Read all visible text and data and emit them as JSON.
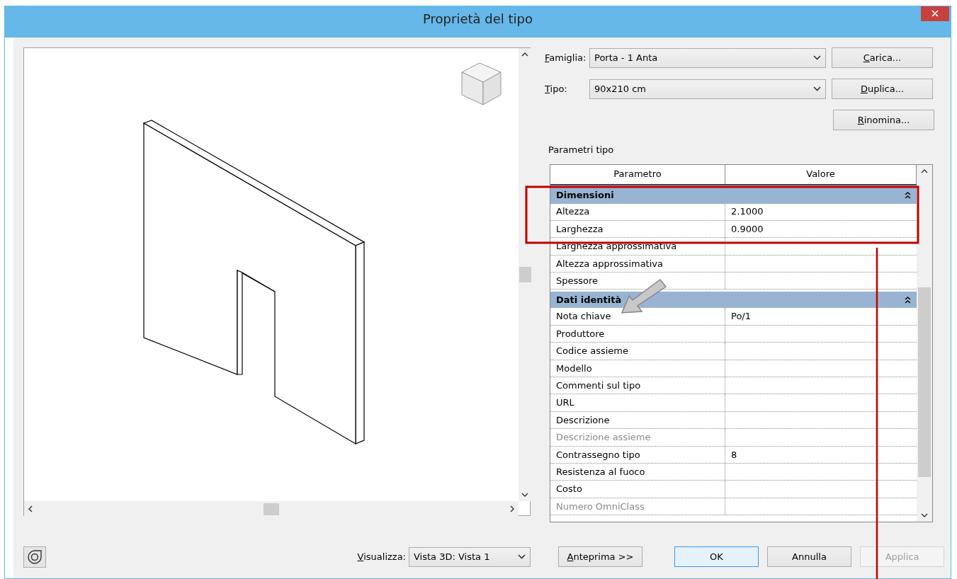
{
  "window": {
    "title": "Proprietà del tipo"
  },
  "family": {
    "label": "Famiglia:",
    "value": "Porta - 1 Anta",
    "mnemonic": true
  },
  "type": {
    "label": "Tipo:",
    "value": "90x210 cm",
    "mnemonic": true
  },
  "side_buttons": [
    {
      "label": "Carica...",
      "mnemonic": true
    },
    {
      "label": "Duplica...",
      "mnemonic": true
    },
    {
      "label": "Rinomina...",
      "mnemonic": true
    }
  ],
  "section_label": "Parametri tipo",
  "table": {
    "columns": [
      "Parametro",
      "Valore"
    ],
    "rows": [
      {
        "kind": "group",
        "label": "Dimensioni",
        "expanded": true
      },
      {
        "kind": "param",
        "name": "Altezza",
        "value": "2.1000",
        "disabled": false
      },
      {
        "kind": "param",
        "name": "Larghezza",
        "value": "0.9000",
        "disabled": false
      },
      {
        "kind": "param",
        "name": "Larghezza approssimativa",
        "disabled": false
      },
      {
        "kind": "param",
        "name": "Altezza approssimativa",
        "disabled": false
      },
      {
        "kind": "param",
        "name": "Spessore",
        "disabled": false
      },
      {
        "kind": "group",
        "label": "Dati identità",
        "expanded": true
      },
      {
        "kind": "param",
        "name": "Nota chiave",
        "value": "Po/1",
        "disabled": false
      },
      {
        "kind": "param",
        "name": "Produttore",
        "disabled": false
      },
      {
        "kind": "param",
        "name": "Codice assieme",
        "disabled": false
      },
      {
        "kind": "param",
        "name": "Modello",
        "disabled": false
      },
      {
        "kind": "param",
        "name": "Commenti sul tipo",
        "disabled": false
      },
      {
        "kind": "param",
        "name": "URL",
        "disabled": false
      },
      {
        "kind": "param",
        "name": "Descrizione",
        "disabled": false
      },
      {
        "kind": "param",
        "name": "Descrizione assieme",
        "disabled": true
      },
      {
        "kind": "param",
        "name": "Contrassegno tipo",
        "value": "8",
        "disabled": false
      },
      {
        "kind": "param",
        "name": "Resistenza al fuoco",
        "disabled": false
      },
      {
        "kind": "param",
        "name": "Costo",
        "disabled": false
      },
      {
        "kind": "param",
        "name": "Numero OmniClass",
        "disabled": true
      }
    ]
  },
  "view": {
    "label": "Visualizza:",
    "value": "Vista 3D: Vista 1",
    "mnemonic": true
  },
  "buttons": [
    {
      "label": "Anteprima >>",
      "mnemonic": true,
      "focused": false,
      "disabled": false
    },
    {
      "label": "OK",
      "mnemonic": false,
      "focused": true,
      "disabled": false
    },
    {
      "label": "Annulla",
      "mnemonic": false,
      "focused": false,
      "disabled": false
    },
    {
      "label": "Applica",
      "mnemonic": false,
      "focused": false,
      "disabled": true
    }
  ]
}
